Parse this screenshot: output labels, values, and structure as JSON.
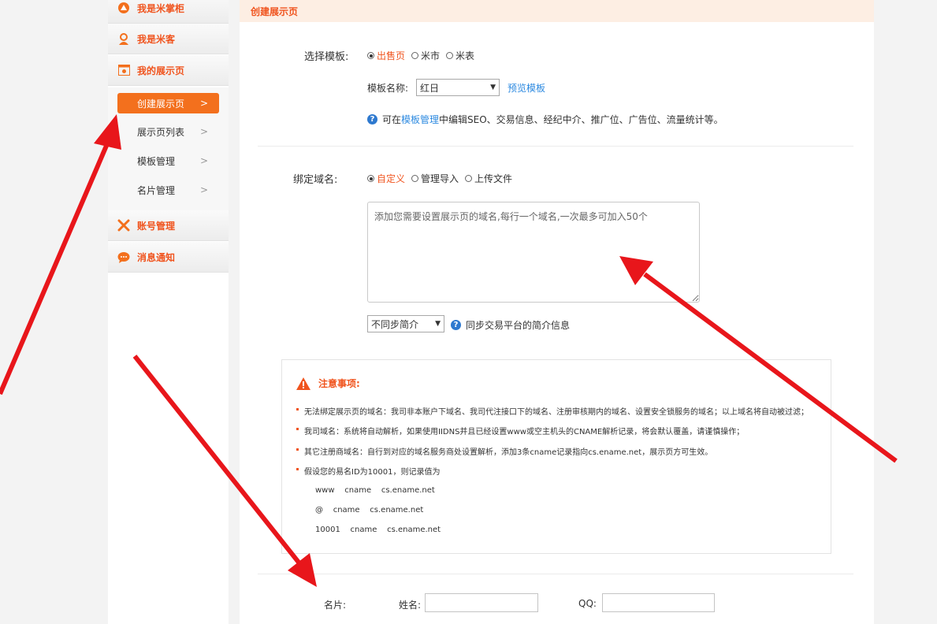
{
  "sidebar": {
    "groups": [
      {
        "label": "我是米掌柜",
        "icon": "seller-icon"
      },
      {
        "label": "我是米客",
        "icon": "user-icon"
      },
      {
        "label": "我的展示页",
        "icon": "showcase-page-icon"
      },
      {
        "label": "账号管理",
        "icon": "tools-icon"
      },
      {
        "label": "消息通知",
        "icon": "chat-bubble-icon"
      }
    ],
    "sub_items": [
      {
        "label": "创建展示页",
        "active": true
      },
      {
        "label": "展示页列表",
        "active": false
      },
      {
        "label": "模板管理",
        "active": false
      },
      {
        "label": "名片管理",
        "active": false
      }
    ],
    "chevron": ">"
  },
  "header": {
    "title": "创建展示页"
  },
  "template": {
    "label": "选择模板:",
    "options": [
      "出售页",
      "米市",
      "米表"
    ],
    "selected": "出售页",
    "name_label": "模板名称:",
    "name_value": "红日",
    "preview_link": "预览模板",
    "help_prefix": "可在",
    "help_link": "模板管理",
    "help_suffix": "中编辑SEO、交易信息、经纪中介、推广位、广告位、流量统计等。"
  },
  "domain": {
    "label": "绑定域名:",
    "options": [
      "自定义",
      "管理导入",
      "上传文件"
    ],
    "selected": "自定义",
    "placeholder": "添加您需要设置展示页的域名,每行一个域名,一次最多可加入50个",
    "sync_select": "不同步简介",
    "sync_help": "同步交易平台的简介信息"
  },
  "notice": {
    "title": "注意事项:",
    "items": [
      "无法绑定展示页的域名：我司非本账户下域名、我司代注接口下的域名、注册审核期内的域名、设置安全锁服务的域名；以上域名将自动被过滤；",
      "我司域名：系统将自动解析，如果使用IIDNS并且已经设置www或空主机头的CNAME解析记录，将会默认覆盖，请谨慎操作；",
      "其它注册商域名：自行到对应的域名服务商处设置解析，添加3条cname记录指向cs.ename.net，展示页方可生效。",
      "假设您的易名ID为10001，则记录值为"
    ],
    "records": [
      "www    cname    cs.ename.net",
      "@    cname    cs.ename.net",
      "10001    cname    cs.ename.net"
    ]
  },
  "card": {
    "label": "名片:",
    "name_label": "姓名:",
    "qq_label": "QQ:"
  },
  "colors": {
    "accent": "#f0541e",
    "active_bg": "#f3701d",
    "arrow": "#e8161b",
    "link": "#2d8ae0"
  }
}
